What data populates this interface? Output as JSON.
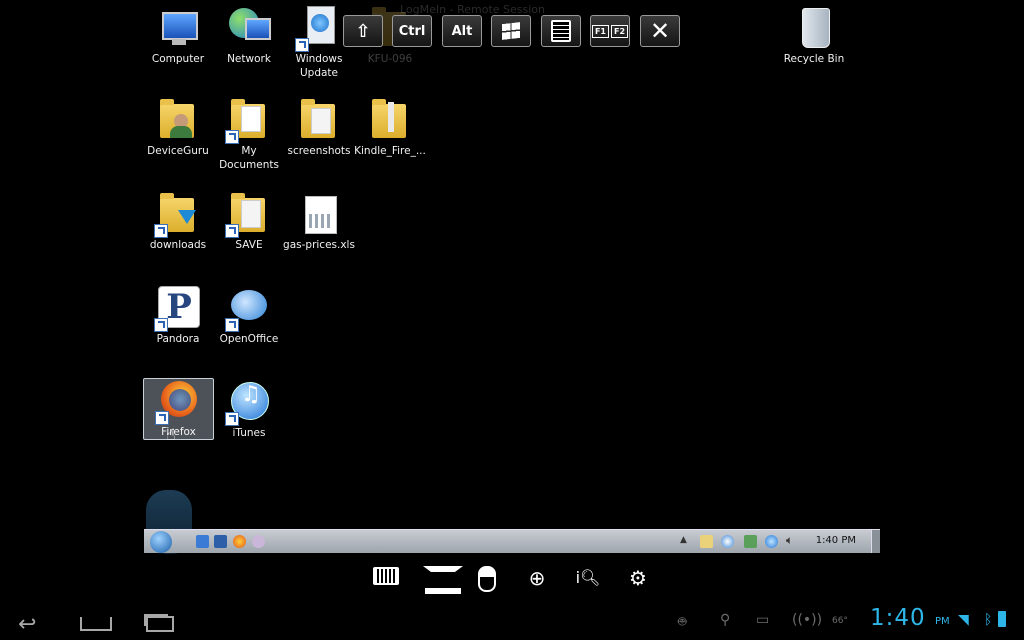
{
  "desktop": {
    "icons": [
      {
        "label": "Computer"
      },
      {
        "label": "Network"
      },
      {
        "label": "Windows Update"
      },
      {
        "label": "DeviceGuru"
      },
      {
        "label": "My Documents"
      },
      {
        "label": "screenshots"
      },
      {
        "label": "Kindle_Fire_..."
      },
      {
        "label": "downloads"
      },
      {
        "label": "SAVE"
      },
      {
        "label": "gas-prices.xls"
      },
      {
        "label": "Pandora"
      },
      {
        "label": "OpenOffice"
      },
      {
        "label": "Firefox"
      },
      {
        "label": "iTunes"
      },
      {
        "label": "Recycle Bin"
      }
    ],
    "ghost_label": "KFU-096",
    "ghost_title": "LogMeIn - Remote Session"
  },
  "remote_toolbar": {
    "ctrl_label": "Ctrl",
    "alt_label": "Alt",
    "f1_label": "F1",
    "f2_label": "F2"
  },
  "taskbar": {
    "clock": "1:40 PM"
  },
  "android": {
    "time": "1:40",
    "ampm": "PM",
    "temperature": "66°"
  },
  "colors": {
    "accent_clock": "#2fb6e8",
    "taskbar": "#b5bbc2"
  }
}
